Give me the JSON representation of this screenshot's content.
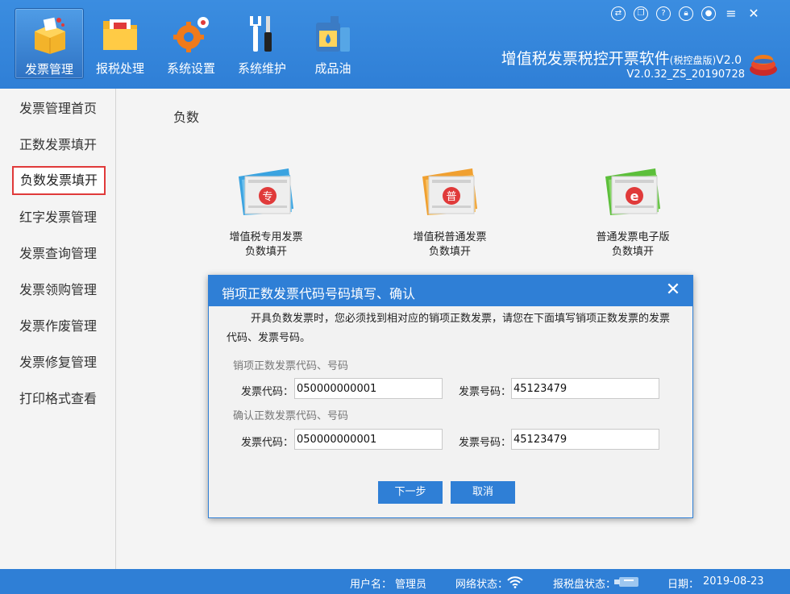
{
  "toolbar": {
    "items": [
      {
        "label": "发票管理",
        "icon": "invoice-box-icon"
      },
      {
        "label": "报税处理",
        "icon": "tax-folder-icon"
      },
      {
        "label": "系统设置",
        "icon": "gear-icon"
      },
      {
        "label": "系统维护",
        "icon": "wrench-screwdriver-icon"
      },
      {
        "label": "成品油",
        "icon": "oil-can-icon"
      }
    ]
  },
  "app": {
    "title": "增值税发票税控开票软件",
    "edition": "(税控盘版)",
    "major_version": "V2.0",
    "build": "V2.0.32_ZS_20190728"
  },
  "window_controls": [
    "swap-icon",
    "copy-icon",
    "help-icon",
    "lock-icon",
    "user-icon",
    "menu-icon",
    "close-icon"
  ],
  "sidebar": {
    "items": [
      {
        "label": "发票管理首页"
      },
      {
        "label": "正数发票填开"
      },
      {
        "label": "负数发票填开"
      },
      {
        "label": "红字发票管理"
      },
      {
        "label": "发票查询管理"
      },
      {
        "label": "发票领购管理"
      },
      {
        "label": "发票作废管理"
      },
      {
        "label": "发票修复管理"
      },
      {
        "label": "打印格式查看"
      }
    ],
    "active_index": 2
  },
  "main": {
    "section_title": "负数",
    "cards": [
      {
        "line1": "增值税专用发票",
        "line2": "负数填开",
        "badge": "专",
        "color": "#3aa3e0"
      },
      {
        "line1": "增值税普通发票",
        "line2": "负数填开",
        "badge": "普",
        "color": "#f0a030"
      },
      {
        "line1": "普通发票电子版",
        "line2": "负数填开",
        "badge": "e",
        "color": "#5cbf3a"
      }
    ]
  },
  "dialog": {
    "title": "销项正数发票代码号码填写、确认",
    "message": "开具负数发票时，您必须找到相对应的销项正数发票，请您在下面填写销项正数发票的发票代码、发票号码。",
    "group1_label": "销项正数发票代码、号码",
    "group2_label": "确认正数发票代码、号码",
    "code_label": "发票代码：",
    "number_label": "发票号码：",
    "code1": "050000000001",
    "number1": "45123479",
    "code2": "050000000001",
    "number2": "45123479",
    "next_button": "下一步",
    "cancel_button": "取消"
  },
  "status": {
    "user_label": "用户名：",
    "user": "管理员",
    "network_label": "网络状态：",
    "disk_label": "报税盘状态：",
    "date_label": "日期：",
    "date": "2019-08-23"
  },
  "colors": {
    "primary": "#2f7fd6",
    "active_border": "#e03a3a"
  }
}
